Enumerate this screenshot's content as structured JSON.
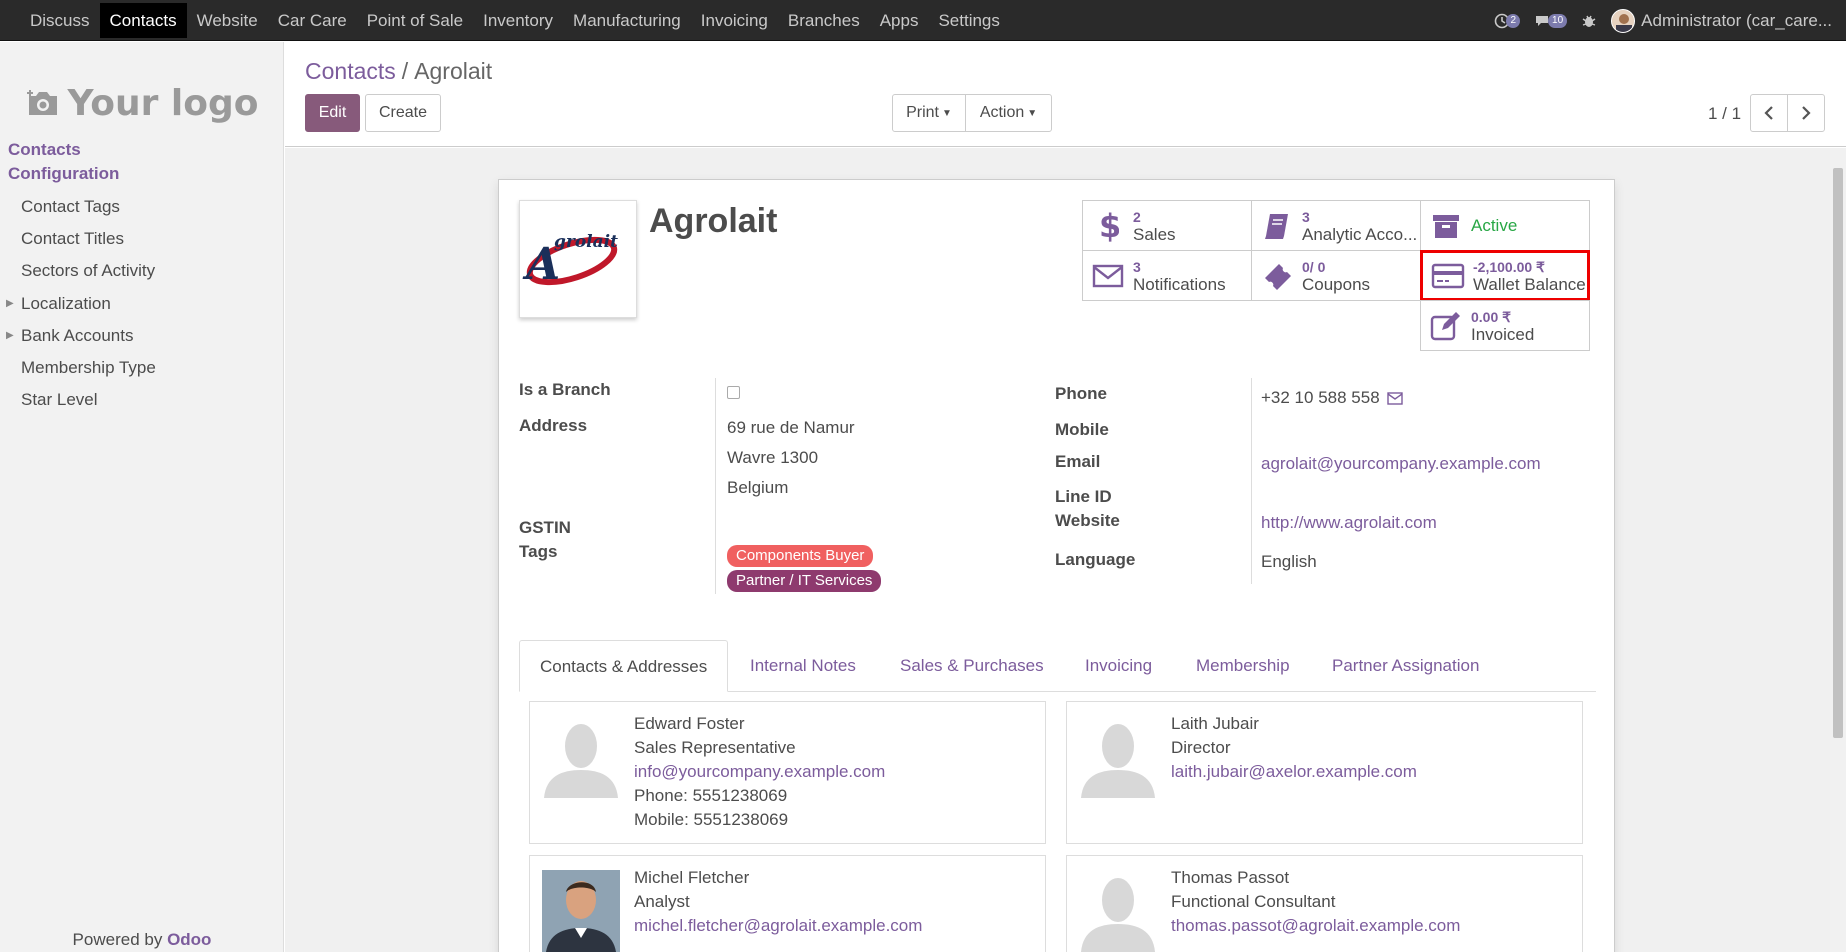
{
  "topnav": {
    "items": [
      {
        "label": "Discuss"
      },
      {
        "label": "Contacts"
      },
      {
        "label": "Website"
      },
      {
        "label": "Car Care"
      },
      {
        "label": "Point of Sale"
      },
      {
        "label": "Inventory"
      },
      {
        "label": "Manufacturing"
      },
      {
        "label": "Invoicing"
      },
      {
        "label": "Branches"
      },
      {
        "label": "Apps"
      },
      {
        "label": "Settings"
      }
    ],
    "activity_count": "2",
    "message_count": "10",
    "user_label": "Administrator (car_care..."
  },
  "sidebar": {
    "logo_text": "Your logo",
    "section_contacts": "Contacts",
    "section_configuration": "Configuration",
    "items": [
      {
        "label": "Contact Tags"
      },
      {
        "label": "Contact Titles"
      },
      {
        "label": "Sectors of Activity"
      },
      {
        "label": "Localization"
      },
      {
        "label": "Bank Accounts"
      },
      {
        "label": "Membership Type"
      },
      {
        "label": "Star Level"
      }
    ],
    "powered_prefix": "Powered by",
    "powered_brand": "Odoo"
  },
  "control_panel": {
    "breadcrumb_parent": "Contacts",
    "breadcrumb_sep": "/",
    "breadcrumb_current": "Agrolait",
    "edit_label": "Edit",
    "create_label": "Create",
    "print_label": "Print",
    "action_label": "Action",
    "pager": "1 / 1"
  },
  "record": {
    "logo_text": "grolait",
    "logo_initial": "A",
    "name": "Agrolait",
    "smart_buttons": [
      {
        "value": "2",
        "label": "Sales",
        "icon": "dollar-icon"
      },
      {
        "value": "3",
        "label": "Analytic Acco...",
        "icon": "book-icon"
      },
      {
        "value": "",
        "label": "Active",
        "icon": "archive-icon"
      },
      {
        "value": "3",
        "label": "Notifications",
        "icon": "envelope-icon"
      },
      {
        "value": "0/ 0",
        "label": "Coupons",
        "icon": "ticket-icon"
      },
      {
        "value": "-2,100.00 ₹",
        "label": "Wallet Balance",
        "icon": "credit-card-icon"
      },
      {
        "value": "0.00 ₹",
        "label": "Invoiced",
        "icon": "edit-icon"
      }
    ],
    "left_fields": {
      "is_branch_label": "Is a Branch",
      "address_label": "Address",
      "address_line1": "69 rue de Namur",
      "address_line2": "Wavre 1300",
      "address_line3": "Belgium",
      "gstin_label": "GSTIN",
      "tags_label": "Tags",
      "tags": [
        {
          "label": "Components Buyer",
          "color": "#f06060"
        },
        {
          "label": "Partner / IT Services",
          "color": "#8e3a6e"
        }
      ]
    },
    "right_fields": {
      "phone_label": "Phone",
      "phone": "+32 10 588 558",
      "mobile_label": "Mobile",
      "email_label": "Email",
      "email": "agrolait@yourcompany.example.com",
      "lineid_label": "Line ID",
      "website_label": "Website",
      "website": "http://www.agrolait.com",
      "language_label": "Language",
      "language": "English"
    },
    "tabs": [
      {
        "label": "Contacts & Addresses"
      },
      {
        "label": "Internal Notes"
      },
      {
        "label": "Sales & Purchases"
      },
      {
        "label": "Invoicing"
      },
      {
        "label": "Membership"
      },
      {
        "label": "Partner Assignation"
      }
    ],
    "contacts": [
      {
        "name": "Edward Foster",
        "role": "Sales Representative",
        "email": "info@yourcompany.example.com",
        "phone": "Phone: 5551238069",
        "mobile": "Mobile: 5551238069"
      },
      {
        "name": "Laith Jubair",
        "role": "Director",
        "email": "laith.jubair@axelor.example.com"
      },
      {
        "name": "Michel Fletcher",
        "role": "Analyst",
        "email": "michel.fletcher@agrolait.example.com"
      },
      {
        "name": "Thomas Passot",
        "role": "Functional Consultant",
        "email": "thomas.passot@agrolait.example.com"
      }
    ]
  },
  "colors": {
    "brand": "#875a7b",
    "link": "#7c5c9c",
    "active_status": "#28a745",
    "highlight": "#e00000"
  }
}
